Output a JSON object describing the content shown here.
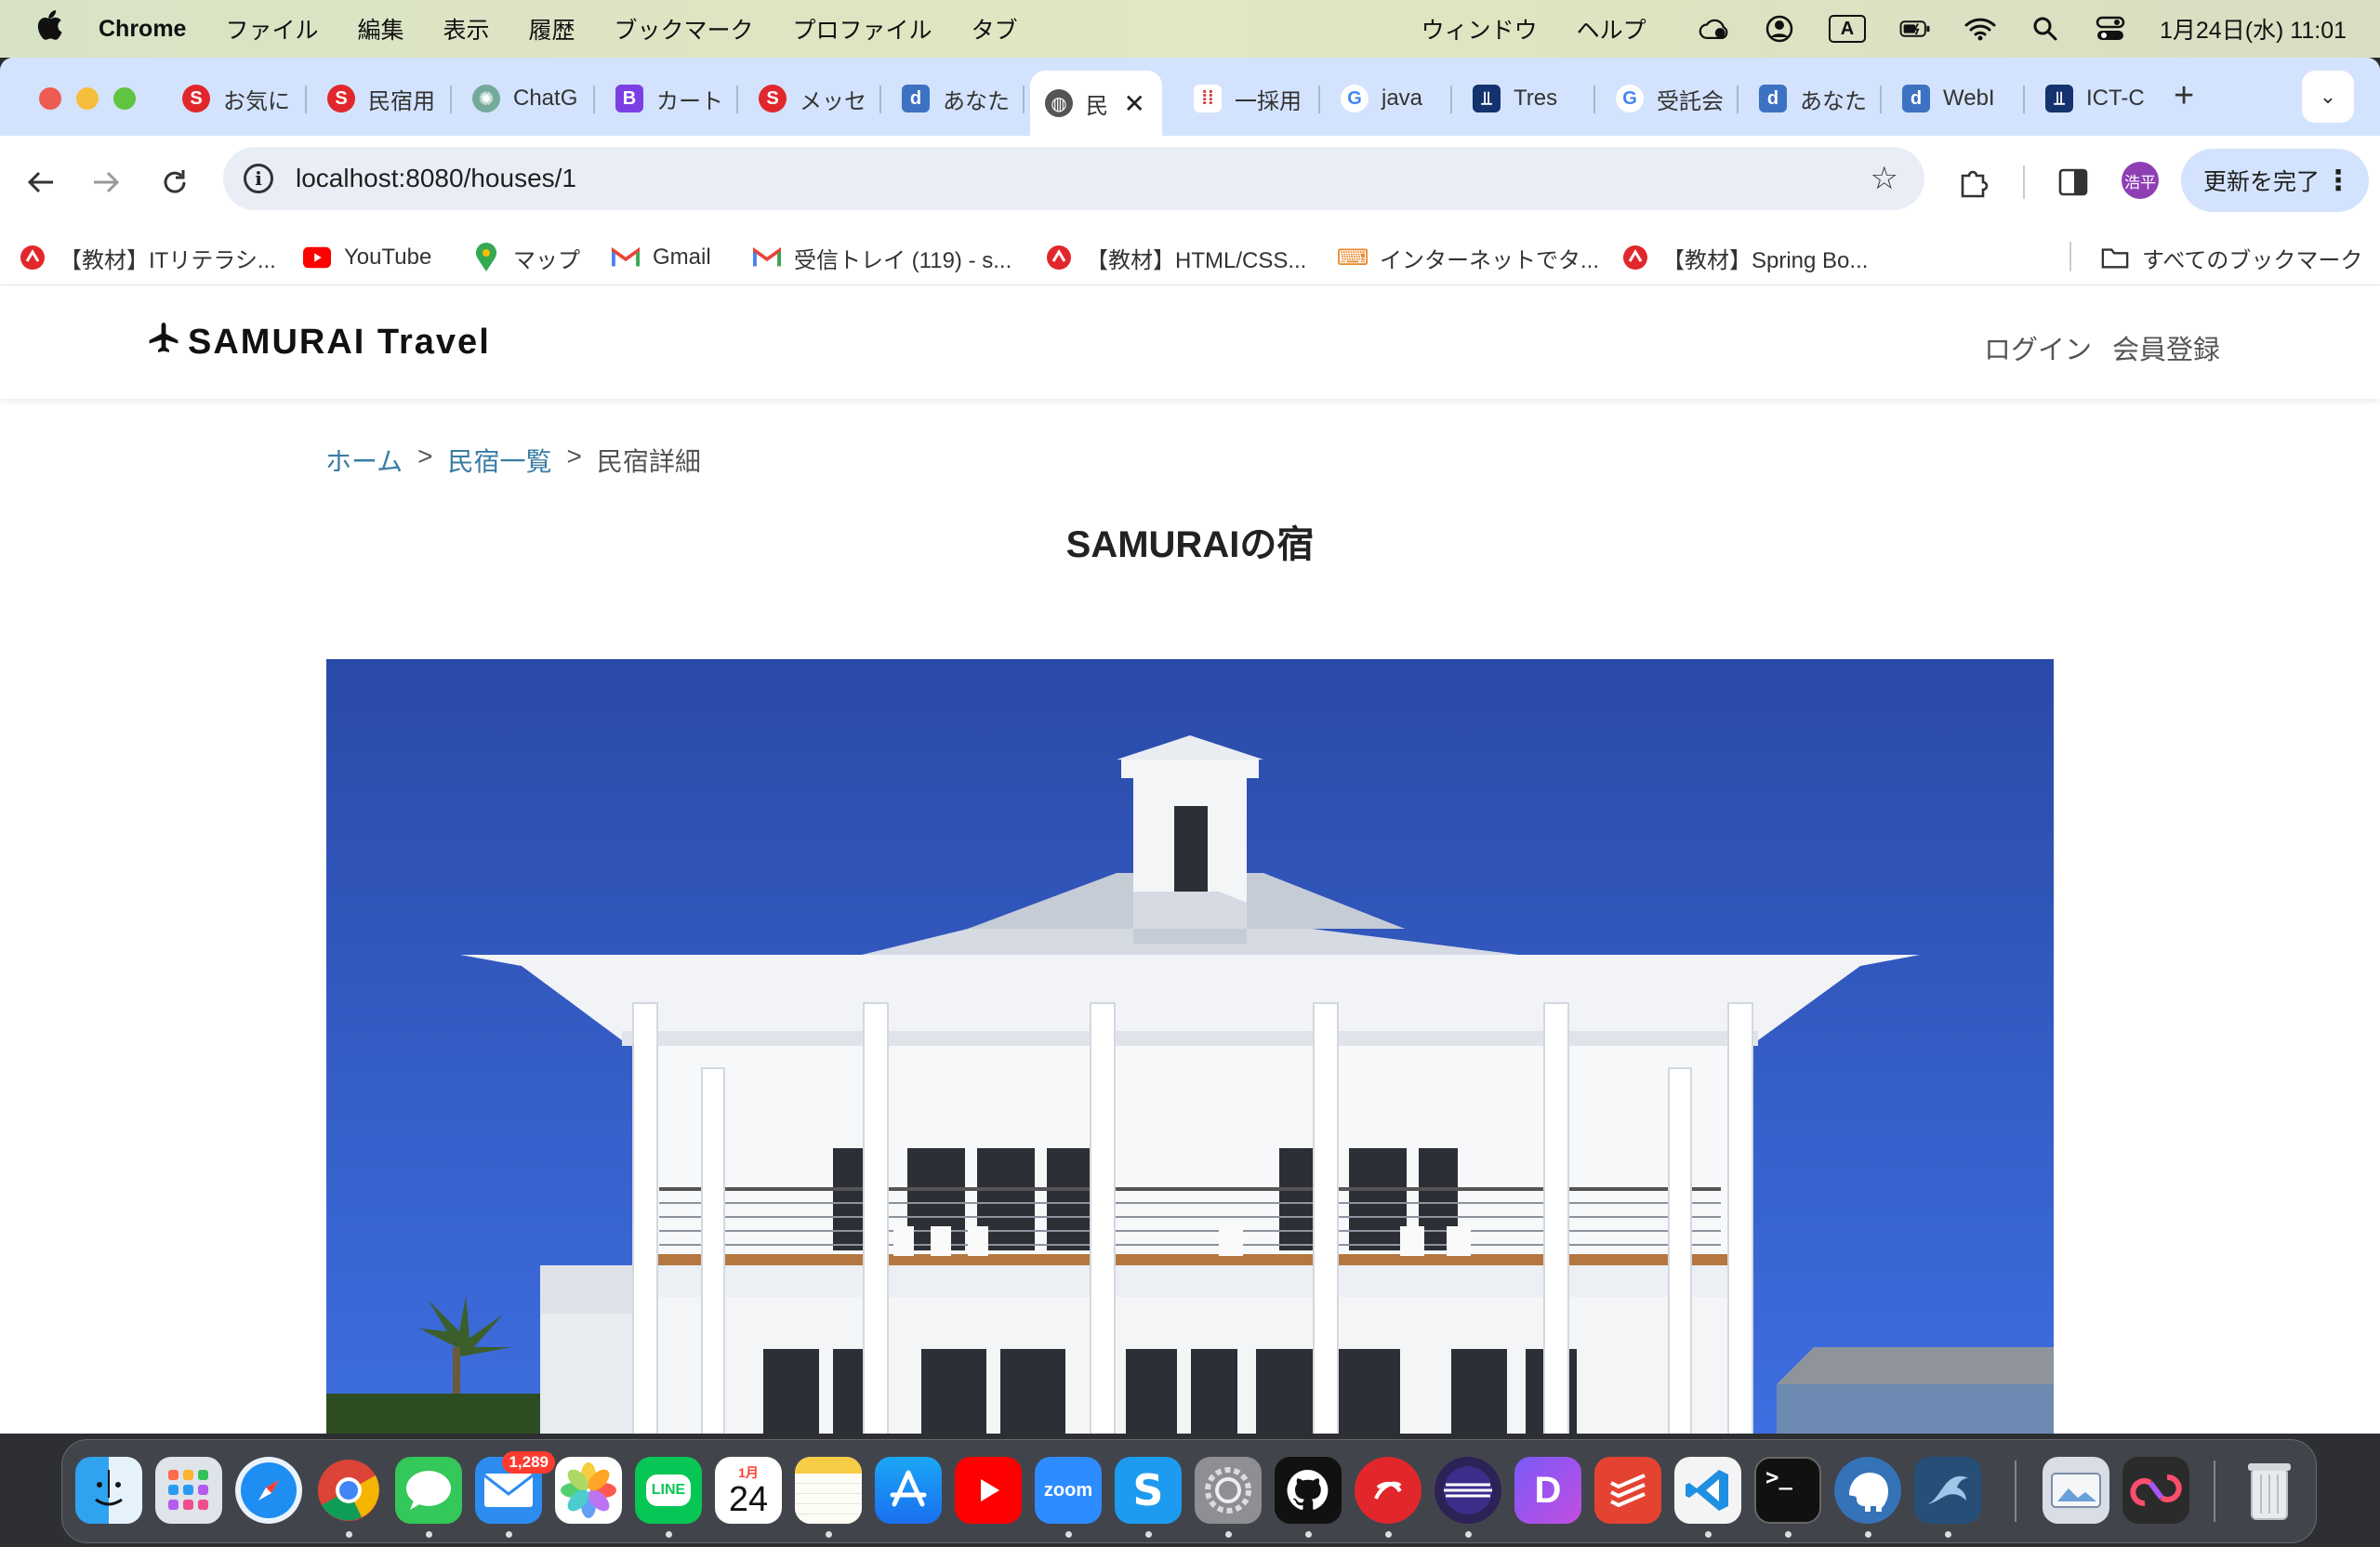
{
  "menubar": {
    "app_name": "Chrome",
    "items": [
      "ファイル",
      "編集",
      "表示",
      "履歴",
      "ブックマーク",
      "プロファイル",
      "タブ",
      "ウィンドウ",
      "ヘルプ"
    ],
    "input_mode": "A",
    "clock": "1月24日(水) 11:01"
  },
  "tabs": [
    {
      "title": "お気に",
      "icon": "samurai-icon"
    },
    {
      "title": "民宿用",
      "icon": "samurai-icon"
    },
    {
      "title": "ChatG",
      "icon": "chatgpt-icon"
    },
    {
      "title": "カート",
      "icon": "bootstrap-icon"
    },
    {
      "title": "メッセ",
      "icon": "samurai-icon"
    },
    {
      "title": "あなた",
      "icon": "d-icon"
    },
    {
      "title": "民",
      "icon": "globe-icon",
      "active": true
    },
    {
      "title": "一採用",
      "icon": "people-icon"
    },
    {
      "title": "java",
      "icon": "google-icon"
    },
    {
      "title": "Tres",
      "icon": "tres-icon"
    },
    {
      "title": "受託会",
      "icon": "google-icon"
    },
    {
      "title": "あなた",
      "icon": "d-icon"
    },
    {
      "title": "WebI",
      "icon": "d-icon"
    },
    {
      "title": "ICT-C",
      "icon": "tres-icon"
    }
  ],
  "toolbar": {
    "url": "localhost:8080/houses/1",
    "profile_initial": "浩平",
    "update_label": "更新を完了"
  },
  "bookmarks": [
    {
      "label": "【教材】ITリテラシ...",
      "icon": "samurai-icon"
    },
    {
      "label": "YouTube",
      "icon": "youtube-icon"
    },
    {
      "label": "マップ",
      "icon": "maps-icon"
    },
    {
      "label": "Gmail",
      "icon": "gmail-icon"
    },
    {
      "label": "受信トレイ (119) - s...",
      "icon": "gmail-icon"
    },
    {
      "label": "【教材】HTML/CSS...",
      "icon": "samurai-icon"
    },
    {
      "label": "インターネットでタ...",
      "icon": "typing-icon"
    },
    {
      "label": "【教材】Spring Bo...",
      "icon": "samurai-icon"
    }
  ],
  "all_bookmarks_label": "すべてのブックマーク",
  "site": {
    "logo": "SAMURAI Travel",
    "login": "ログイン",
    "signup": "会員登録",
    "breadcrumb": {
      "home": "ホーム",
      "list": "民宿一覧",
      "current": "民宿詳細",
      "separator": ">"
    },
    "house_name": "SAMURAIの宿"
  },
  "dock": {
    "mail_badge": "1,289",
    "calendar_month": "1月",
    "calendar_day": "24",
    "zoom_label": "zoom",
    "line_label": "LINE"
  },
  "colors": {
    "tabstrip": "#d3e3fd",
    "link": "#3a7ca5",
    "sky": "#2f56c4"
  }
}
